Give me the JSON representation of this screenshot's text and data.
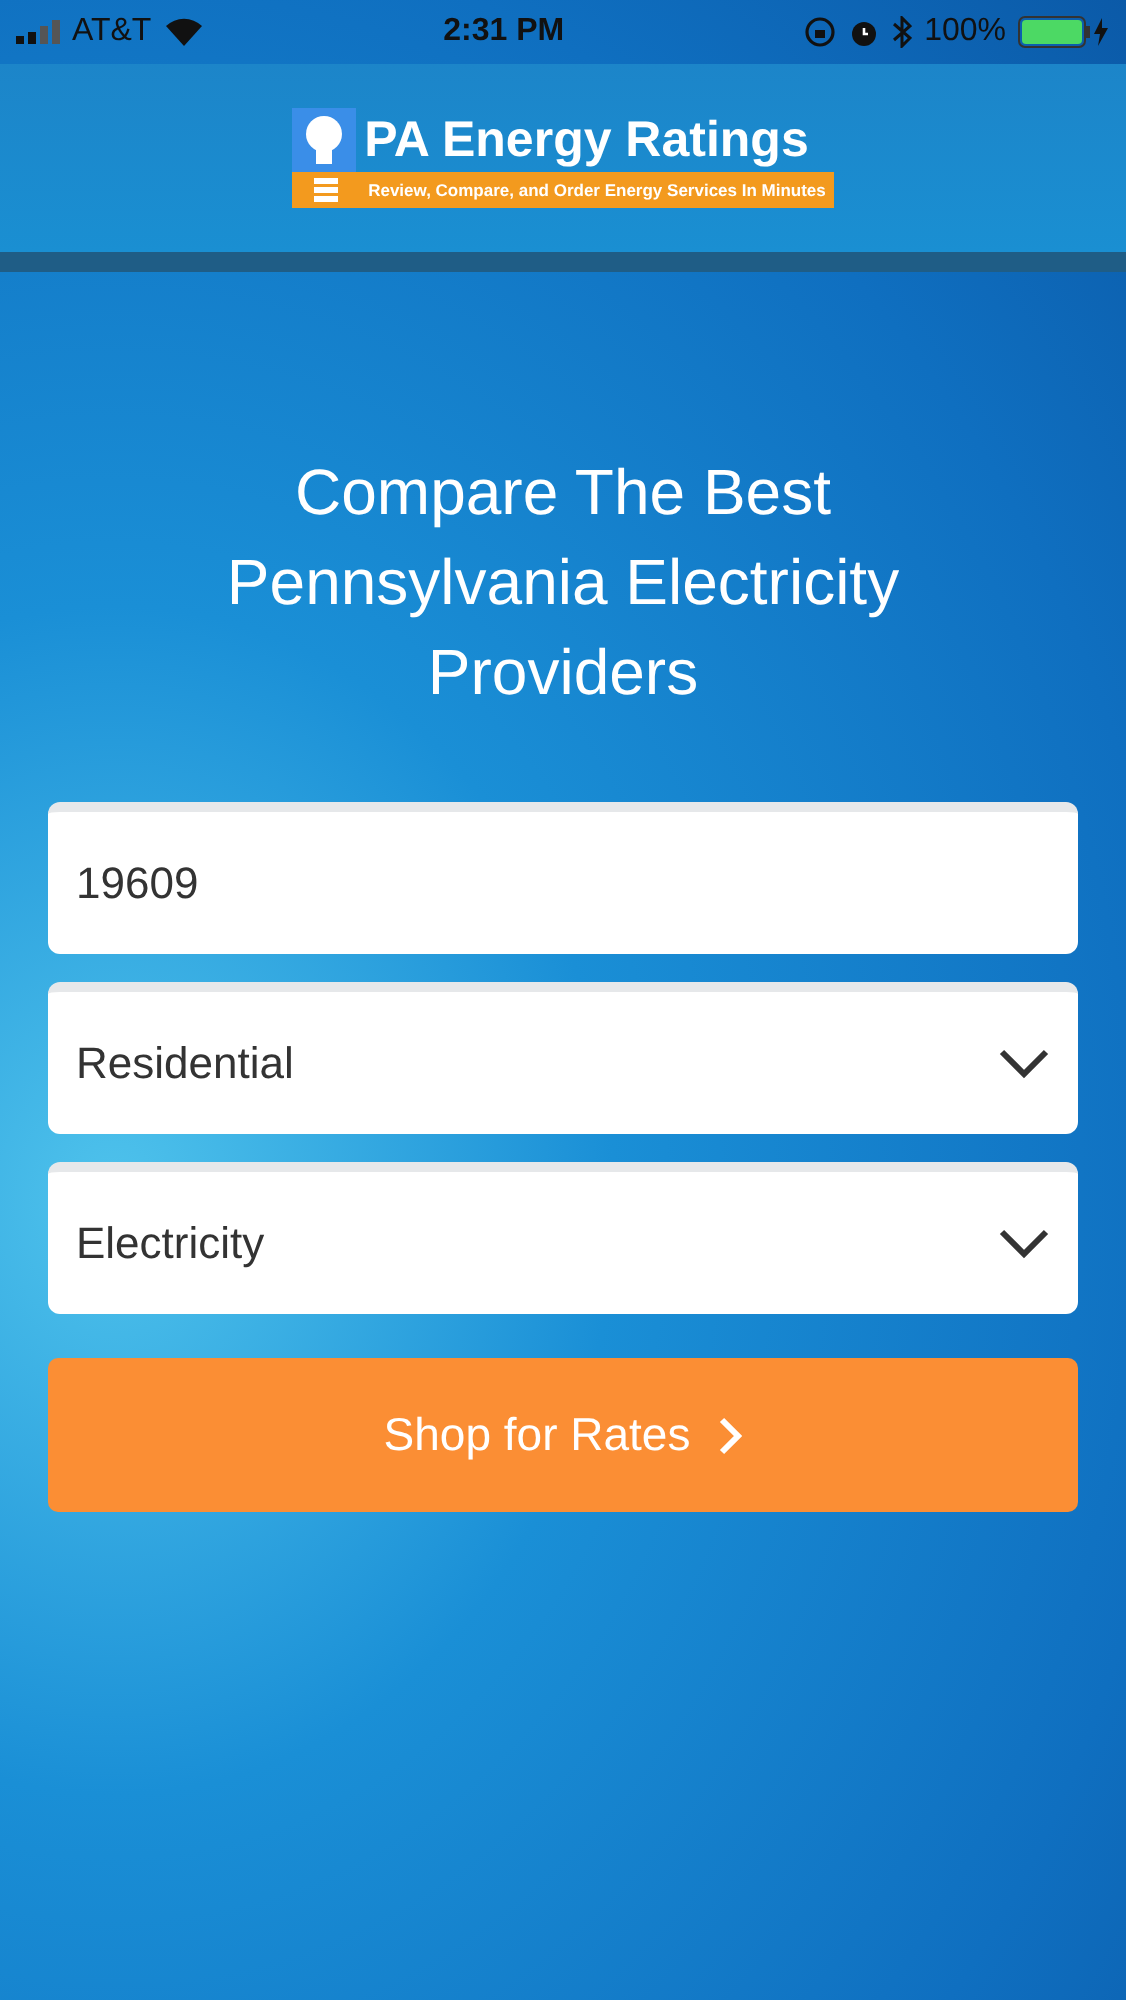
{
  "status_bar": {
    "carrier": "AT&T",
    "time": "2:31 PM",
    "battery": "100%"
  },
  "header": {
    "title": "PA Energy Ratings",
    "tagline": "Review, Compare, and Order Energy Services In Minutes"
  },
  "headline": "Compare The Best Pennsylvania Electricity Providers",
  "form": {
    "fields": [
      {
        "kind": "input",
        "value": "19609"
      },
      {
        "kind": "select",
        "value": "Residential"
      },
      {
        "kind": "select",
        "value": "Electricity"
      }
    ],
    "submit": {
      "label": "Shop for Rates"
    }
  }
}
